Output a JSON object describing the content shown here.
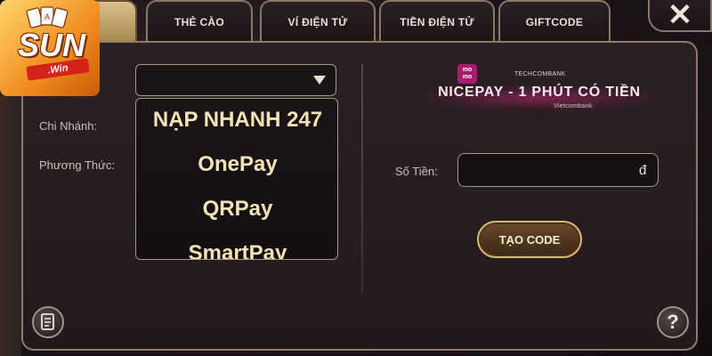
{
  "logo": {
    "brand": "SUN",
    "sub": ".Win"
  },
  "tabs": [
    {
      "label": "THẺ CÀO"
    },
    {
      "label": "VÍ ĐIỆN TỬ"
    },
    {
      "label": "TIỀN ĐIỆN TỬ"
    },
    {
      "label": "GIFTCODE"
    }
  ],
  "close_glyph": "✕",
  "form": {
    "branch_label": "Chi Nhánh:",
    "method_label": "Phương Thức:",
    "dropdown_options": [
      "NẠP NHANH 247",
      "OnePay",
      "QRPay",
      "SmartPay"
    ],
    "amount_label": "Số Tiền:",
    "currency": "đ",
    "create_button": "TẠO CODE"
  },
  "banner": {
    "momo": "mo mo",
    "techcombank": "TECHCOMBANK",
    "title": "NICEPAY - 1 PHÚT CÓ TIỀN",
    "vietcombank": "Vietcombank"
  },
  "footer": {
    "help_glyph": "?"
  },
  "colors": {
    "gold_text": "#f3e4b8",
    "border": "#8e7c66",
    "momo": "#a81e6c",
    "banner_glow": "#be286e"
  }
}
